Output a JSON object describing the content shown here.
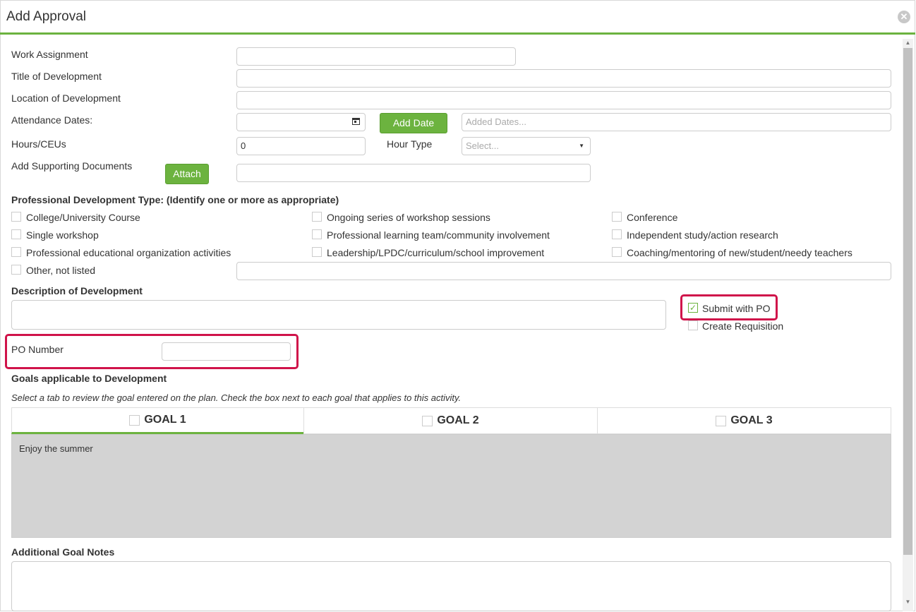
{
  "dialog": {
    "title": "Add Approval",
    "close_glyph": "✕"
  },
  "form": {
    "work_assignment_label": "Work Assignment",
    "work_assignment_value": "",
    "title_label": "Title of Development",
    "title_value": "",
    "location_label": "Location of Development",
    "location_value": "",
    "attendance_label": "Attendance Dates:",
    "attendance_value": "",
    "add_date_button": "Add Date",
    "added_dates_placeholder": "Added Dates...",
    "hours_label": "Hours/CEUs",
    "hours_value": "0",
    "hour_type_label": "Hour Type",
    "hour_type_selected": "Select...",
    "supporting_docs_label": "Add Supporting Documents",
    "attach_button": "Attach",
    "attach_value": ""
  },
  "pd_type": {
    "heading": "Professional Development Type: (Identify one or more as appropriate)",
    "options": [
      {
        "label": "College/University Course",
        "checked": false
      },
      {
        "label": "Ongoing series of workshop sessions",
        "checked": false
      },
      {
        "label": "Conference",
        "checked": false
      },
      {
        "label": "Single workshop",
        "checked": false
      },
      {
        "label": "Professional learning team/community involvement",
        "checked": false
      },
      {
        "label": "Independent study/action research",
        "checked": false
      },
      {
        "label": "Professional educational organization activities",
        "checked": false
      },
      {
        "label": "Leadership/LPDC/curriculum/school improvement",
        "checked": false
      },
      {
        "label": "Coaching/mentoring of new/student/needy teachers",
        "checked": false
      }
    ],
    "other_label": "Other, not listed",
    "other_value": ""
  },
  "description": {
    "label": "Description of Development",
    "value": ""
  },
  "submit_with_po": {
    "label": "Submit with PO",
    "checked": true
  },
  "create_requisition": {
    "label": "Create Requisition",
    "checked": false
  },
  "po_number": {
    "label": "PO Number",
    "value": ""
  },
  "goals": {
    "heading": "Goals applicable to Development",
    "instructions": "Select a tab to review the goal entered on the plan. Check the box next to each goal that applies to this activity.",
    "tabs": [
      {
        "label": "GOAL 1",
        "checked": false
      },
      {
        "label": "GOAL 2",
        "checked": false
      },
      {
        "label": "GOAL 3",
        "checked": false
      }
    ],
    "active_goal_text": "Enjoy the summer"
  },
  "additional_notes": {
    "label": "Additional Goal Notes",
    "value": ""
  },
  "icons": {
    "calendar": "calendar-icon",
    "dropdown": "caret-down-icon",
    "close": "close-icon",
    "check": "checkmark-icon"
  },
  "colors": {
    "accent": "#6cb33f",
    "highlight": "#d0134a"
  }
}
